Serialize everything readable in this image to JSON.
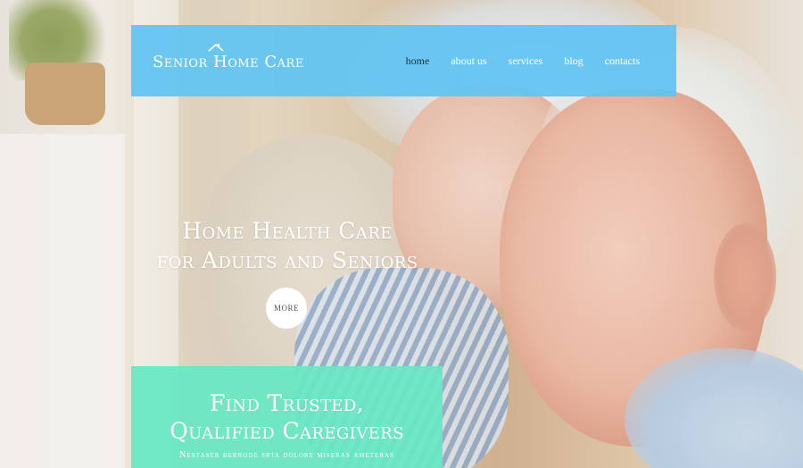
{
  "header": {
    "logo_text": "Senior Home Care",
    "nav": [
      {
        "label": "home",
        "active": true
      },
      {
        "label": "about us",
        "active": false
      },
      {
        "label": "services",
        "active": false
      },
      {
        "label": "blog",
        "active": false
      },
      {
        "label": "contacts",
        "active": false
      }
    ]
  },
  "hero": {
    "title_line1": "Home Health Care",
    "title_line2": "for Adults and Seniors",
    "more_label": "MORE"
  },
  "promo": {
    "title_line1": "Find Trusted,",
    "title_line2": "Qualified Caregivers",
    "text": "Nertaser berrode srta dolore miseras ameteras"
  },
  "colors": {
    "header_bg": "#61c4f2",
    "promo_bg": "#66e8c2",
    "nav_active": "#20333d",
    "text_light": "#ffffff"
  },
  "icons": {
    "logo_mark": "roof-icon"
  }
}
